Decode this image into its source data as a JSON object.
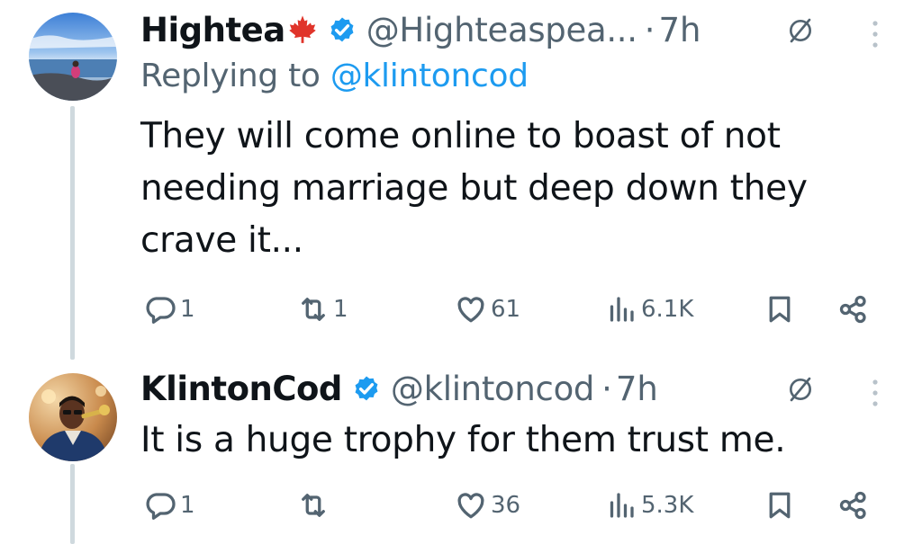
{
  "tweets": [
    {
      "display_name": "Hightea",
      "flag_emoji": "maple-leaf-icon",
      "handle": "@Highteaspea...",
      "separator": "·",
      "time": "7h",
      "replying_prefix": "Replying to ",
      "replying_handle": "@klintoncod",
      "text": "They will come online to boast of not needing marriage but deep down they crave it...",
      "replies": "1",
      "reposts": "1",
      "likes": "61",
      "views": "6.1K"
    },
    {
      "display_name": "KlintonCod",
      "handle": "@klintoncod",
      "separator": "·",
      "time": "7h",
      "text": "It is a huge trophy for them trust me.",
      "replies": "1",
      "reposts": "",
      "likes": "36",
      "views": "5.3K"
    }
  ],
  "colors": {
    "accent": "#1d9bf0",
    "muted": "#536471",
    "text": "#0f1419",
    "thread_line": "#cfd9de",
    "maple_leaf": "#e0342a"
  }
}
